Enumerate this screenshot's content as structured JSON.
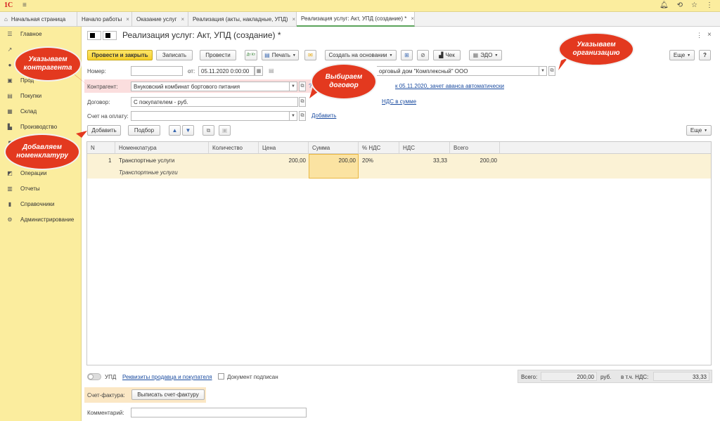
{
  "app": {
    "logo": "1С",
    "menu_glyph": "≡"
  },
  "tabs": [
    {
      "label": "Начальная страница"
    },
    {
      "label": "Начало работы"
    },
    {
      "label": "Оказание услуг"
    },
    {
      "label": "Реализация (акты, накладные, УПД)"
    },
    {
      "label": "Реализация услуг: Акт, УПД (создание) *"
    }
  ],
  "sidebar": {
    "items": [
      {
        "label": "Главное",
        "icon": "menu-icon"
      },
      {
        "label": "",
        "icon": "chart-icon"
      },
      {
        "label": "",
        "icon": "bank-icon"
      },
      {
        "label": "Прод",
        "icon": "sales-icon"
      },
      {
        "label": "Покупки",
        "icon": "cart-icon"
      },
      {
        "label": "Склад",
        "icon": "warehouse-icon"
      },
      {
        "label": "Производство",
        "icon": "factory-icon"
      },
      {
        "label": "",
        "icon": "assets-icon"
      },
      {
        "label": "",
        "icon": "staff-icon"
      },
      {
        "label": "Операции",
        "icon": "operations-icon"
      },
      {
        "label": "Отчеты",
        "icon": "reports-icon"
      },
      {
        "label": "Справочники",
        "icon": "book-icon"
      },
      {
        "label": "Администрирование",
        "icon": "gear-icon"
      }
    ]
  },
  "document": {
    "title": "Реализация услуг: Акт, УПД (создание) *"
  },
  "toolbar": {
    "post_close": "Провести и закрыть",
    "save": "Записать",
    "post": "Провести",
    "dt_kt": "Дт Кт",
    "print": "Печать",
    "create_based": "Создать на основании",
    "check": "Чек",
    "edo": "ЭДО",
    "more": "Еще",
    "help": "?"
  },
  "form": {
    "number_label": "Номер:",
    "number_value": "",
    "date_label": "от:",
    "date_value": "05.11.2020  0:00:00",
    "org_value": "орговый дом \"Комплексный\" ООО",
    "counterparty_label": "Контрагент:",
    "counterparty_value": "Внуковский комбинат бортового питания",
    "contract_label": "Договор:",
    "contract_value": "С покупателем - руб.",
    "invoice_label": "Счет на оплату:",
    "invoice_value": "",
    "invoice_link": "Добавить",
    "settlement_link": "к 05.11.2020, зачет аванса автоматически",
    "vat_link": "НДС в сумме"
  },
  "table_toolbar": {
    "add": "Добавить",
    "select": "Подбор",
    "more": "Еще"
  },
  "table": {
    "columns": [
      "N",
      "Номенклатура",
      "Количество",
      "Цена",
      "Сумма",
      "% НДС",
      "НДС",
      "Всего"
    ],
    "rows": [
      {
        "n": "1",
        "item": "Транспортные услуги",
        "item_sub": "Транспортные услуги",
        "qty": "",
        "price": "200,00",
        "sum": "200,00",
        "vat_rate": "20%",
        "vat": "33,33",
        "total": "200,00"
      }
    ]
  },
  "footer": {
    "upd_label": "УПД",
    "requisites_link": "Реквизиты продавца и покупателя",
    "signed_label": "Документ подписан",
    "total_label": "Всего:",
    "total_value": "200,00",
    "currency": "руб.",
    "vat_label": "в т.ч. НДС:",
    "vat_value": "33,33",
    "invoice_label": "Счет-фактура:",
    "invoice_button": "Выписать счет-фактуру",
    "comment_label": "Комментарий:",
    "comment_value": ""
  },
  "callouts": {
    "counterparty": "Указываем контрагента",
    "organization": "Указываем организацию",
    "contract": "Выбираем договор",
    "nomenclature": "Добавляем номенклатуру"
  }
}
